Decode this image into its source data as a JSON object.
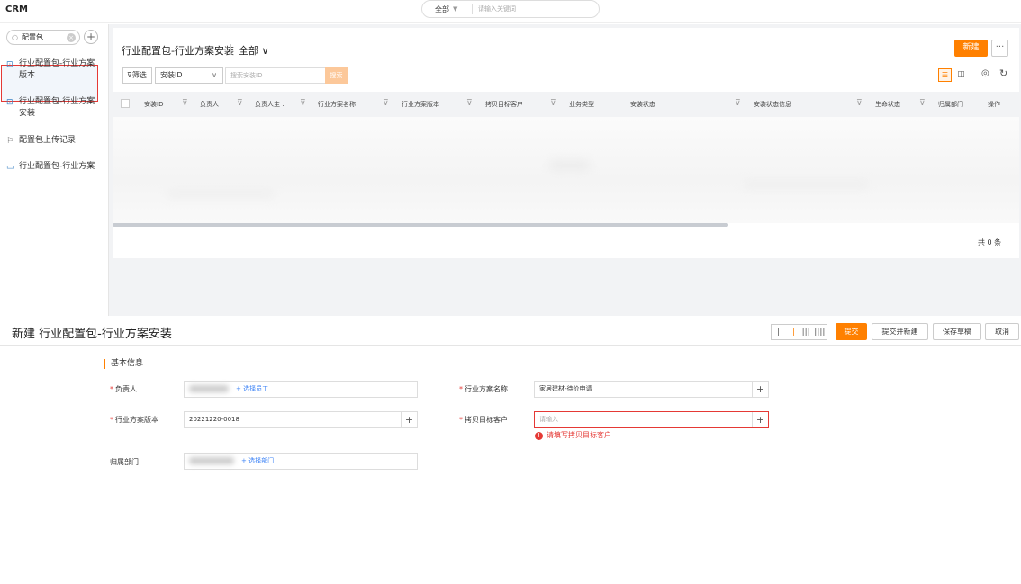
{
  "app": {
    "brand": "CRM"
  },
  "global_search": {
    "scope": "全部",
    "placeholder": "请输入关键词"
  },
  "sidebar": {
    "search_value": "配置包",
    "items": [
      {
        "label_line1": "行业配置包-行业方案",
        "label_line2": "版本"
      },
      {
        "label_line1": "行业配置包-行业方案",
        "label_line2": "安装",
        "selected": true
      },
      {
        "label_line1": "配置包上传记录"
      },
      {
        "label_line1": "行业配置包-行业方案"
      }
    ]
  },
  "list": {
    "title": "行业配置包-行业方案安装",
    "view_filter": "全部 ∨",
    "new_button": "新建",
    "more_button": "···",
    "filter_label": "筛选",
    "field_select": "安装ID",
    "search_placeholder": "搜索安装ID",
    "search_button": "搜索",
    "columns": [
      "安装ID",
      "负责人",
      "负责人主 .",
      "行业方案名称",
      "行业方案版本",
      "拷贝目标客户",
      "业务类型",
      "安装状态",
      "安装状态信息",
      "生命状态",
      "归属部门",
      "操作"
    ],
    "total": "共 0 条"
  },
  "form": {
    "title": "新建 行业配置包-行业方案安装",
    "layout_options": [
      "|",
      "||",
      "|||",
      "||||"
    ],
    "submit": "提交",
    "submit_new": "提交并新建",
    "save_draft": "保存草稿",
    "cancel": "取消",
    "section": "基本信息",
    "fields": {
      "owner_label": "负责人",
      "owner_link": "+ 选择员工",
      "solution_name_label": "行业方案名称",
      "solution_name_value": "家居建材-待价申请",
      "solution_version_label": "行业方案版本",
      "solution_version_value": "20221220-0018",
      "copy_target_label": "拷贝目标客户",
      "copy_target_placeholder": "请输入",
      "copy_target_error": "请填写拷贝目标客户",
      "dept_label": "归属部门",
      "dept_link": "+ 选择部门"
    }
  },
  "colors": {
    "accent": "#ff8000",
    "error": "#e53935",
    "link": "#3b82f6"
  }
}
